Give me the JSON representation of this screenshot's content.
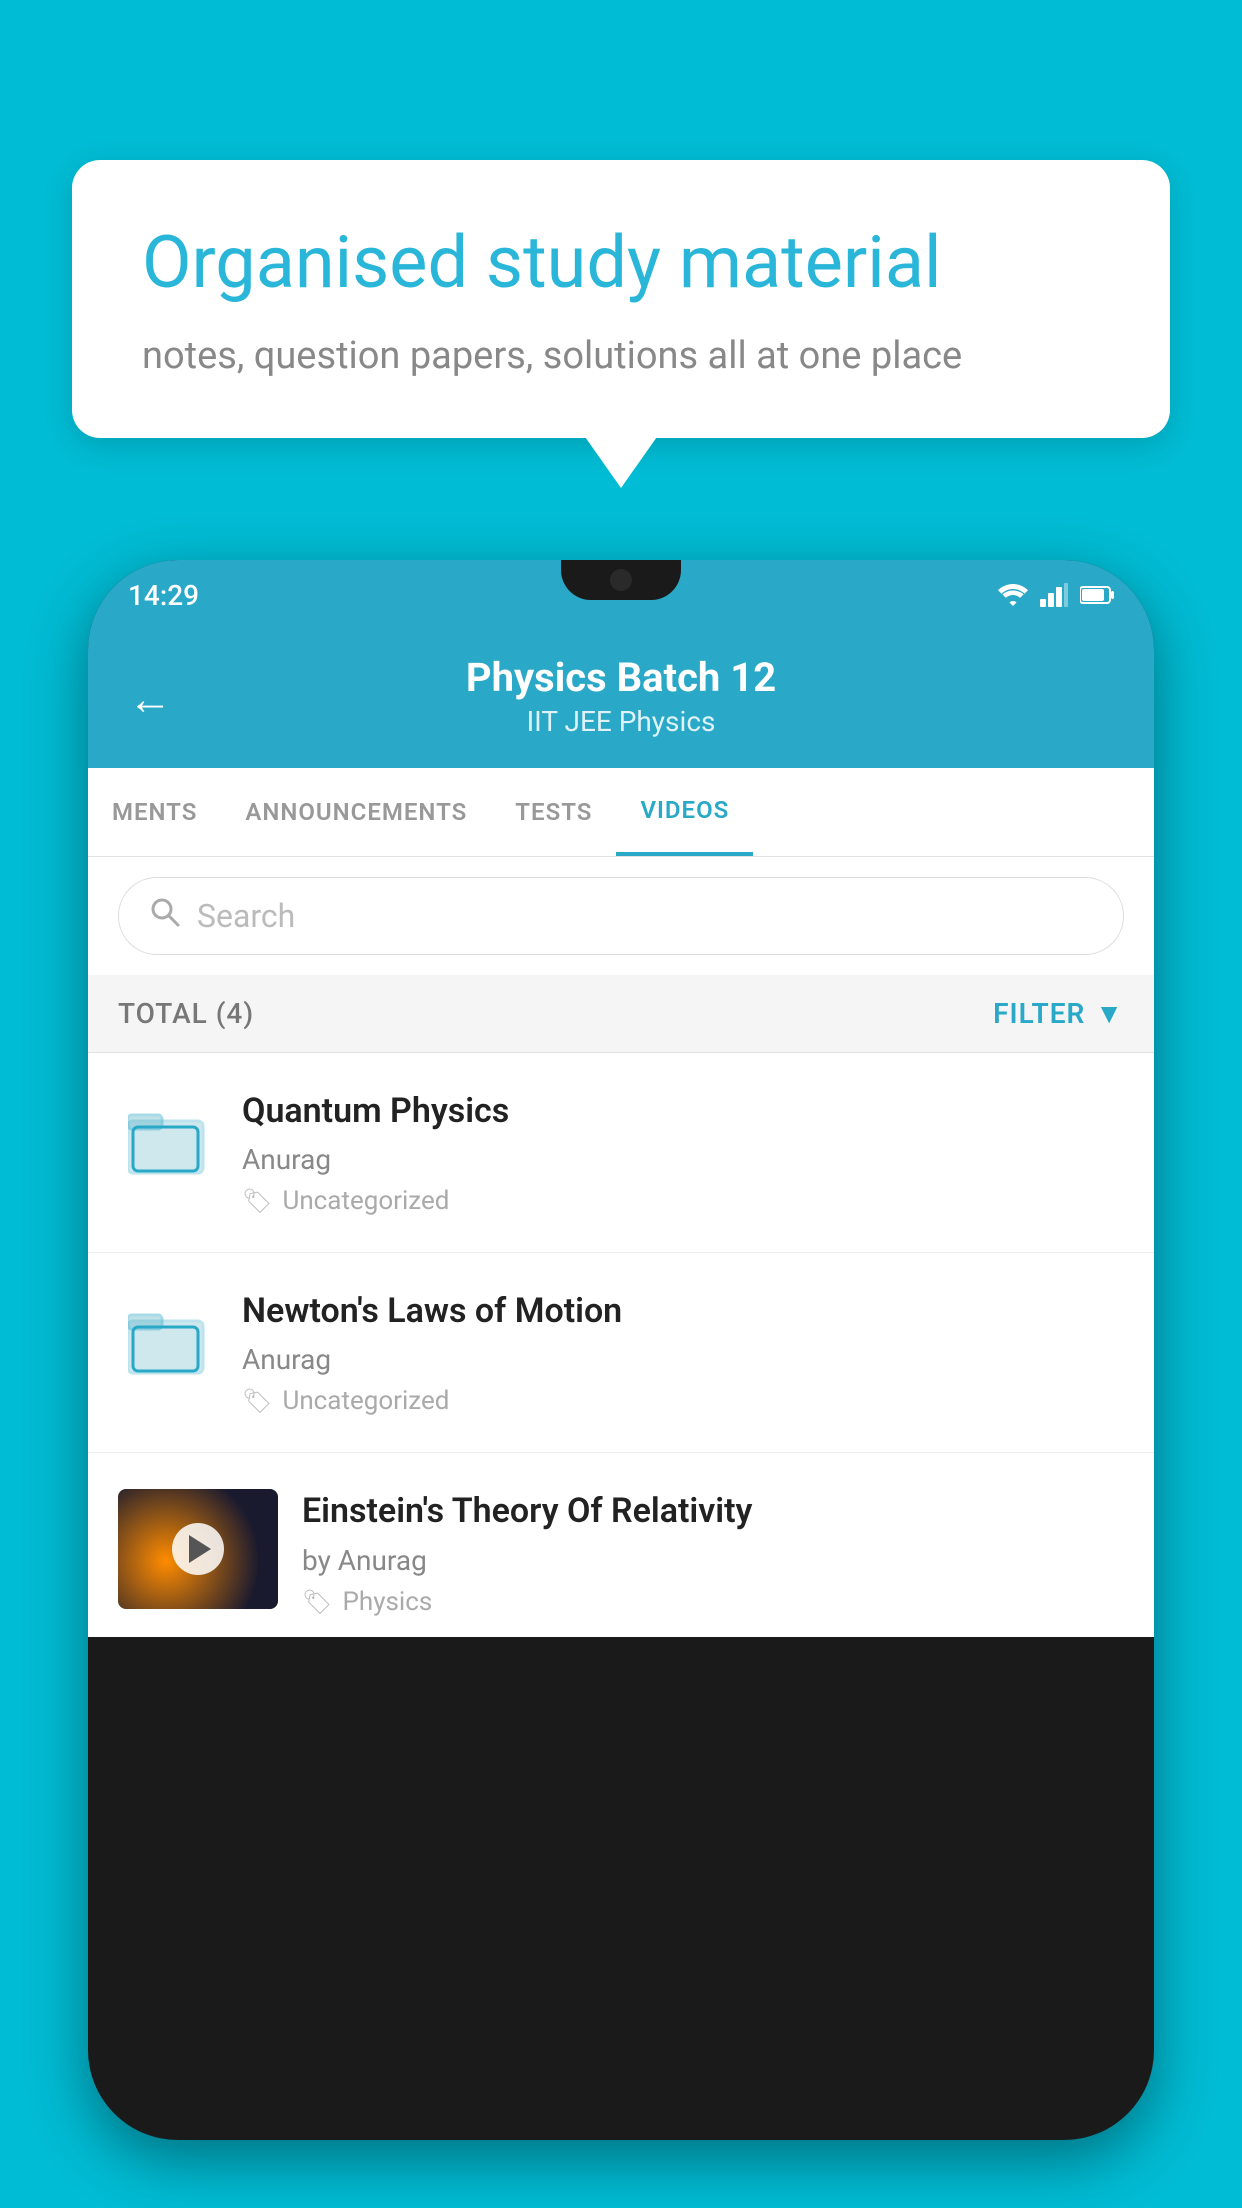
{
  "background_color": "#00bcd4",
  "bubble": {
    "title": "Organised study material",
    "subtitle": "notes, question papers, solutions all at one place"
  },
  "phone": {
    "status_bar": {
      "time": "14:29",
      "icons": [
        "wifi",
        "signal",
        "battery"
      ]
    },
    "header": {
      "title": "Physics Batch 12",
      "subtitle": "IIT JEE   Physics",
      "back_label": "←"
    },
    "tabs": [
      {
        "label": "MENTS",
        "active": false
      },
      {
        "label": "ANNOUNCEMENTS",
        "active": false
      },
      {
        "label": "TESTS",
        "active": false
      },
      {
        "label": "VIDEOS",
        "active": true
      }
    ],
    "search": {
      "placeholder": "Search"
    },
    "filter_bar": {
      "total_text": "TOTAL (4)",
      "filter_label": "FILTER"
    },
    "videos": [
      {
        "id": "1",
        "title": "Quantum Physics",
        "author": "Anurag",
        "tag": "Uncategorized",
        "has_thumb": false
      },
      {
        "id": "2",
        "title": "Newton's Laws of Motion",
        "author": "Anurag",
        "tag": "Uncategorized",
        "has_thumb": false
      },
      {
        "id": "3",
        "title": "Einstein's Theory Of Relativity",
        "author": "by Anurag",
        "tag": "Physics",
        "has_thumb": true
      }
    ]
  }
}
